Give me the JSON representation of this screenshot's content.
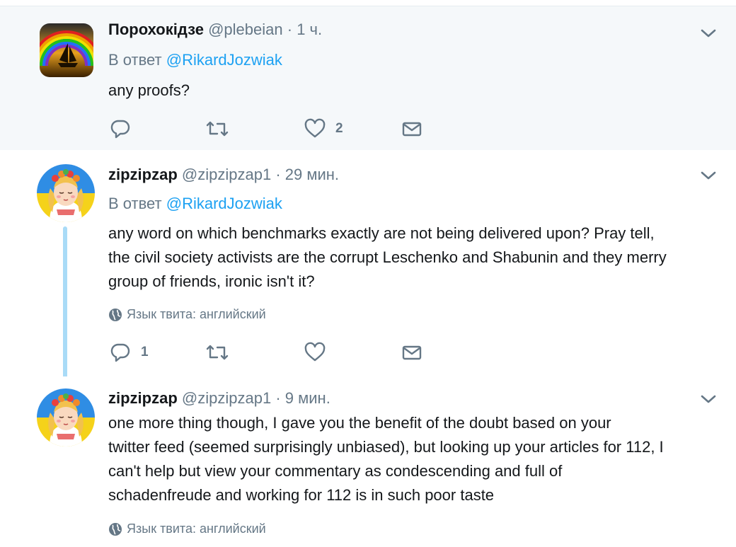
{
  "tweets": [
    {
      "name": "Порохокідзе",
      "handle": "@plebeian",
      "separator": "·",
      "time": "1 ч.",
      "reply_prefix": "В ответ",
      "reply_mention": "@RikardJozwiak",
      "text": "any proofs?",
      "reply_count": "",
      "like_count": "2"
    },
    {
      "name": "zipzipzap",
      "handle": "@zipzipzap1",
      "separator": "·",
      "time": "29 мин.",
      "reply_prefix": "В ответ",
      "reply_mention": "@RikardJozwiak",
      "text_lines": [
        "any word on which benchmarks exactly are not being delivered upon? Pray tell,",
        "the civil society activists are the corrupt Leschenko and Shabunin and they merry",
        "group of friends, ironic isn't it?"
      ],
      "language": "Язык твита: английский",
      "reply_count": "1",
      "like_count": ""
    },
    {
      "name": "zipzipzap",
      "handle": "@zipzipzap1",
      "separator": "·",
      "time": "9 мин.",
      "text_lines": [
        "one more thing though, I gave you the benefit of the doubt based on your",
        "twitter feed (seemed surprisingly unbiased), but looking up your articles for 112, I",
        "can't help but view your commentary as condescending and full of",
        "schadenfreude and working for 112 is in such poor taste"
      ],
      "language": "Язык твита: английский"
    }
  ],
  "icons": {
    "reply": "reply-icon",
    "retweet": "retweet-icon",
    "like": "heart-icon",
    "dm": "envelope-icon",
    "more": "chevron-down-icon",
    "globe": "globe-icon"
  },
  "colors": {
    "link": "#1da1f2",
    "muted": "#657786",
    "thread_line": "#a9dbf7",
    "highlight_bg": "#f5f8fa"
  }
}
